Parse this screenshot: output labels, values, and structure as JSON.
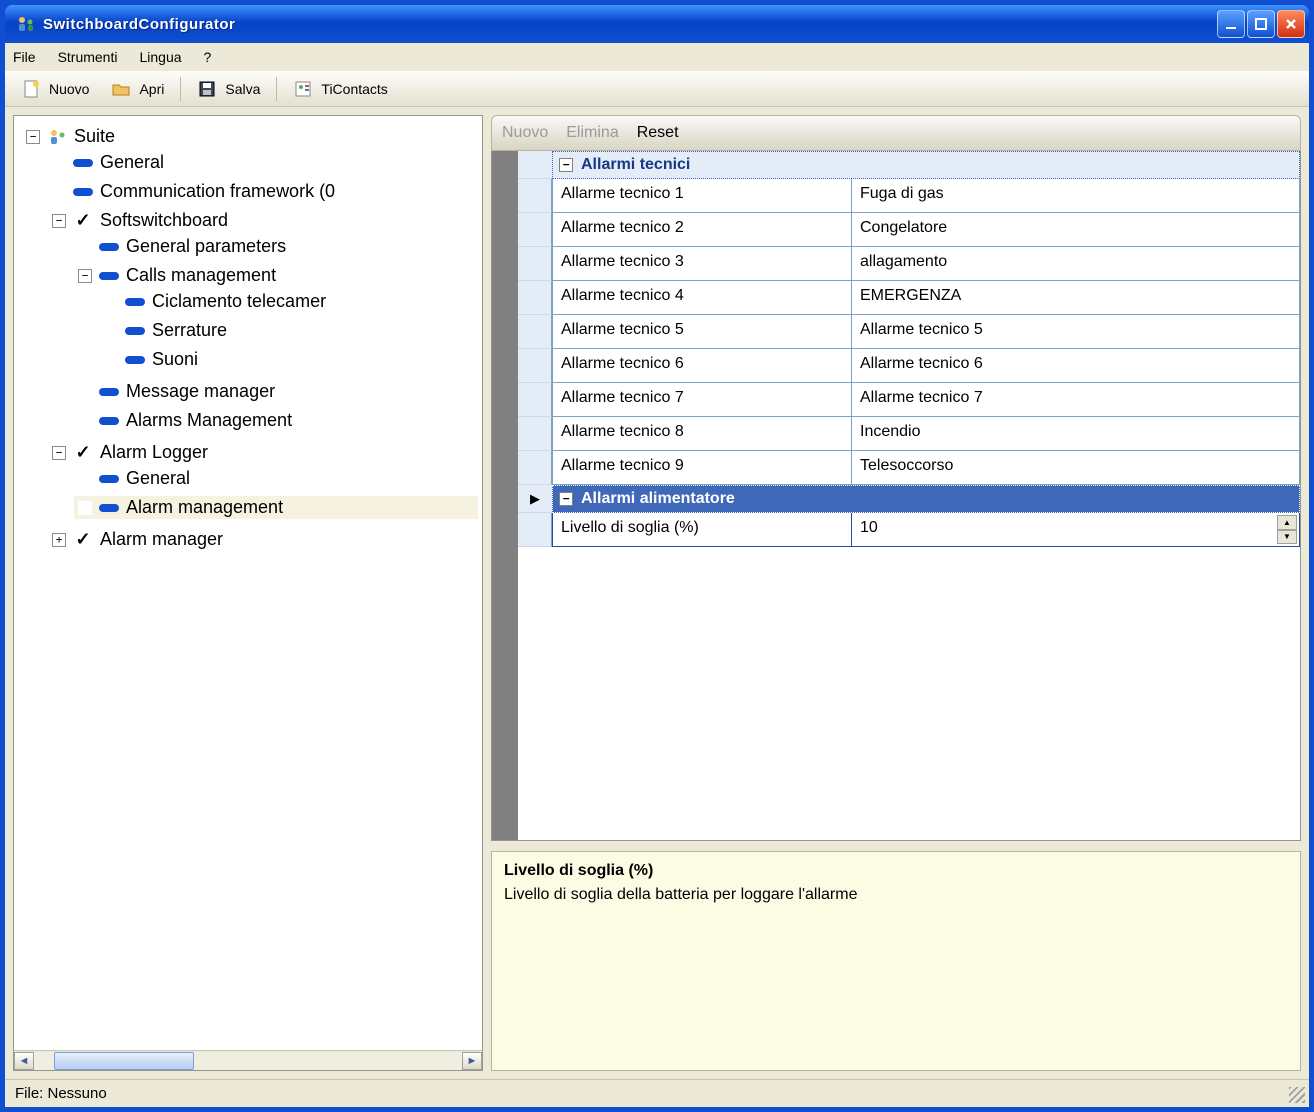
{
  "window": {
    "title": "SwitchboardConfigurator"
  },
  "menu": {
    "file": "File",
    "tools": "Strumenti",
    "lang": "Lingua",
    "help": "?"
  },
  "toolbar": {
    "nuovo": "Nuovo",
    "apri": "Apri",
    "salva": "Salva",
    "ticontacts": "TiContacts"
  },
  "tree": {
    "suite": "Suite",
    "general": "General",
    "commfw": "Communication framework (0",
    "softsb": "Softswitchboard",
    "genparam": "General parameters",
    "callsmgmt": "Calls management",
    "ciclamento": "Ciclamento telecamer",
    "serrature": "Serrature",
    "suoni": "Suoni",
    "msgmgr": "Message manager",
    "alarmsmgmt": "Alarms Management",
    "alarmlogger": "Alarm Logger",
    "algeneral": "General",
    "almgmt": "Alarm management",
    "alarmmanager": "Alarm manager"
  },
  "rtoolbar": {
    "nuovo": "Nuovo",
    "elimina": "Elimina",
    "reset": "Reset"
  },
  "grid": {
    "cat1": "Allarmi tecnici",
    "rows": [
      {
        "k": "Allarme tecnico 1",
        "v": "Fuga di gas"
      },
      {
        "k": "Allarme tecnico 2",
        "v": "Congelatore"
      },
      {
        "k": "Allarme tecnico 3",
        "v": "allagamento"
      },
      {
        "k": "Allarme tecnico 4",
        "v": "EMERGENZA"
      },
      {
        "k": "Allarme tecnico 5",
        "v": "Allarme tecnico 5"
      },
      {
        "k": "Allarme tecnico 6",
        "v": "Allarme tecnico 6"
      },
      {
        "k": "Allarme tecnico 7",
        "v": "Allarme tecnico 7"
      },
      {
        "k": "Allarme tecnico 8",
        "v": "Incendio"
      },
      {
        "k": "Allarme tecnico 9",
        "v": "Telesoccorso"
      }
    ],
    "cat2": "Allarmi alimentatore",
    "thresholdKey": "Livello di soglia (%)",
    "thresholdVal": "10"
  },
  "help": {
    "title": "Livello di soglia (%)",
    "text": "Livello di soglia della batteria per loggare l'allarme"
  },
  "status": {
    "file": "File: Nessuno"
  }
}
